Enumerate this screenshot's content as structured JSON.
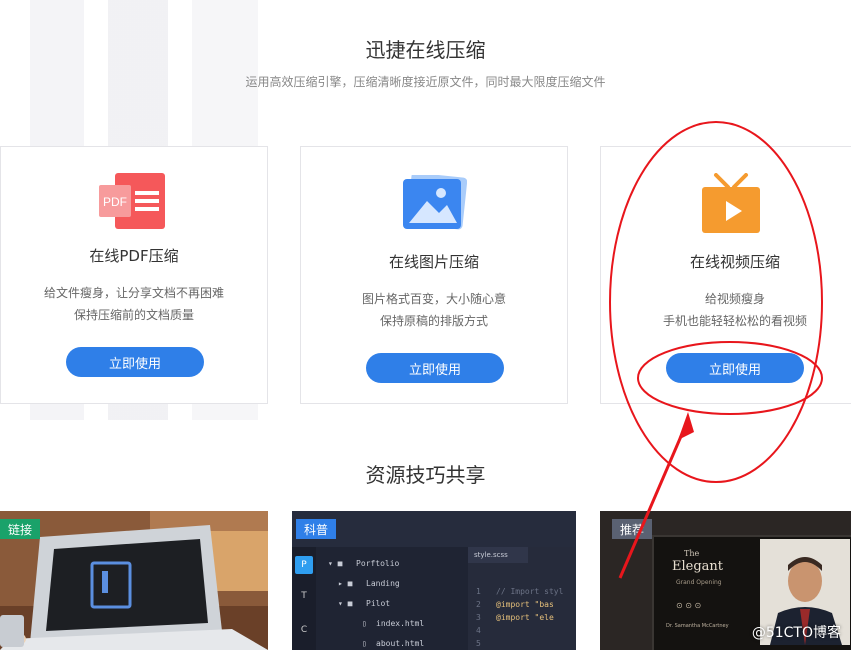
{
  "section1": {
    "title": "迅捷在线压缩",
    "subtitle": "运用高效压缩引擎，压缩清晰度接近原文件，同时最大限度压缩文件"
  },
  "cards": [
    {
      "title": "在线PDF压缩",
      "line1": "给文件瘦身，让分享文档不再困难",
      "line2": "保持压缩前的文档质量",
      "button": "立即使用",
      "icon": "pdf-icon",
      "icon_text": "PDF"
    },
    {
      "title": "在线图片压缩",
      "line1": "图片格式百变，大小随心意",
      "line2": "保持原稿的排版方式",
      "button": "立即使用",
      "icon": "image-icon"
    },
    {
      "title": "在线视频压缩",
      "line1": "给视频瘦身",
      "line2": "手机也能轻轻松松的看视频",
      "button": "立即使用",
      "icon": "tv-video-icon"
    }
  ],
  "section2": {
    "title": "资源技巧共享"
  },
  "resources": [
    {
      "tag": "链接",
      "tag_color": "#1aa26a"
    },
    {
      "tag": "科普",
      "tag_color": "#2f7fe8",
      "editor": {
        "tab": "style.scss",
        "sidebar_letters": [
          "P",
          "T",
          "C"
        ],
        "tree": [
          "Porftolio",
          "Landing",
          "Pilot",
          "index.html",
          "about.html"
        ],
        "lines": [
          "1",
          "2",
          "3",
          "4",
          "5"
        ],
        "code": [
          "// Import styl",
          "@import \"bas",
          "@import \"ele"
        ]
      }
    },
    {
      "tag": "推荐",
      "tag_color": "#5a6172",
      "magazine": {
        "the": "The",
        "title": "Elegant",
        "sub": "Grand Opening",
        "author": "Dr. Samantha McCartney"
      }
    }
  ],
  "watermark": "@51CTO博客",
  "colors": {
    "primary": "#2f7fe8",
    "pdf": "#f5585a",
    "image": "#3b86f0",
    "video": "#f59b2f",
    "annotation": "#e8161c"
  }
}
